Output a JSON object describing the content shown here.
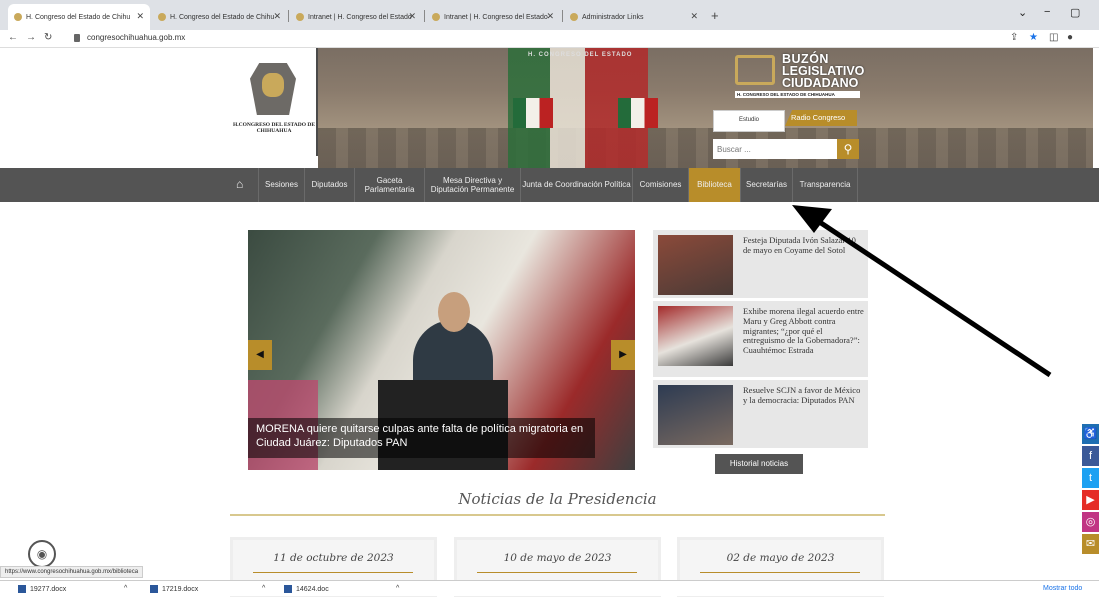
{
  "browser": {
    "tabs": [
      {
        "label": "H. Congreso del Estado de Chihu"
      },
      {
        "label": "H. Congreso del Estado de Chihu"
      },
      {
        "label": "Intranet | H. Congreso del Estado"
      },
      {
        "label": "Intranet | H. Congreso del Estado"
      },
      {
        "label": "Administrador Links"
      }
    ],
    "url": "congresochihuahua.gob.mx",
    "status_url": "https://www.congresochihuahua.gob.mx/biblioteca"
  },
  "header": {
    "banner_text": "H. CONGRESO DEL ESTADO",
    "logo_text": "H.CONGRESO DEL ESTADO DE CHIHUAHUA",
    "buzon_line1": "BUZÓN",
    "buzon_line2": "LEGISLATIVO",
    "buzon_line3": "CIUDADANO",
    "buzon_sub": "H. CONGRESO DEL ESTADO DE CHIHUAHUA",
    "radio_wave": "Estudio",
    "radio_label": "Radio Congreso",
    "search_placeholder": "Buscar ..."
  },
  "nav": {
    "items": [
      {
        "label": "Sesiones"
      },
      {
        "label": "Diputados"
      },
      {
        "label": "Gaceta Parlamentaria"
      },
      {
        "label": "Mesa Directiva y Diputación Permanente"
      },
      {
        "label": "Junta de Coordinación Política"
      },
      {
        "label": "Comisiones"
      },
      {
        "label": "Biblioteca"
      },
      {
        "label": "Secretarías"
      },
      {
        "label": "Transparencia"
      }
    ]
  },
  "slider": {
    "caption": "MORENA quiere quitarse culpas ante falta de política migratoria en Ciudad Juárez: Diputados PAN"
  },
  "news": [
    {
      "title": "Festeja Diputada Ivón Salazar 10 de mayo en Coyame del Sotol"
    },
    {
      "title": "Exhibe morena ilegal acuerdo entre Maru y Greg Abbott contra migrantes; “¿por qué el entreguismo de la Gobernadora?”: Cuauhtémoc Estrada"
    },
    {
      "title": "Resuelve SCJN a favor de México y la democracia: Diputados PAN"
    }
  ],
  "history_button": "Historial noticias",
  "presidencia": {
    "title": "Noticias de la Presidencia",
    "dates": [
      "11 de octubre de 2023",
      "10 de mayo de 2023",
      "02 de mayo de 2023"
    ]
  },
  "downloads": {
    "items": [
      "19277.docx",
      "17219.docx",
      "14624.doc"
    ],
    "show_all": "Mostrar todo"
  },
  "colors": {
    "accent": "#b88d2a",
    "nav_bg": "#545454"
  }
}
